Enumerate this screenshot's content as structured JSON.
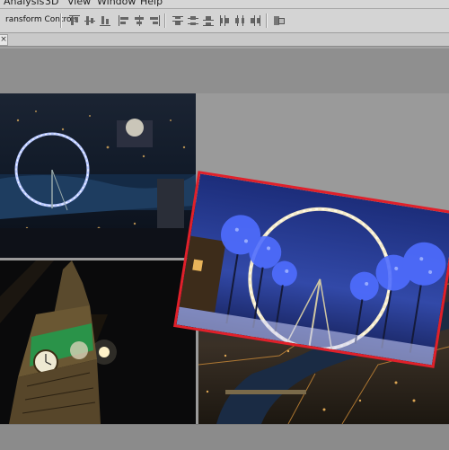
{
  "menubar": {
    "items": [
      "Analysis",
      "3D",
      "View",
      "Window",
      "Help"
    ]
  },
  "optionsbar": {
    "transform_label": "ransform Controls",
    "align_buttons": [
      "align-top-edges",
      "align-vertical-centers",
      "align-bottom-edges",
      "align-left-edges",
      "align-horizontal-centers",
      "align-right-edges"
    ],
    "distribute_buttons": [
      "distribute-top-edges",
      "distribute-vertical-centers",
      "distribute-bottom-edges",
      "distribute-left-edges",
      "distribute-horizontal-centers",
      "distribute-right-edges"
    ],
    "auto_align_button": "auto-align-layers"
  },
  "tabbar": {
    "close_symbol": "×"
  },
  "document": {
    "photos": [
      "london-eye-aerial-night",
      "big-ben-clock-tower-night",
      "london-eye-blue-lit-trees",
      "thames-aerial-city-lights"
    ],
    "selected_layer_outline_color": "#e0202a"
  }
}
